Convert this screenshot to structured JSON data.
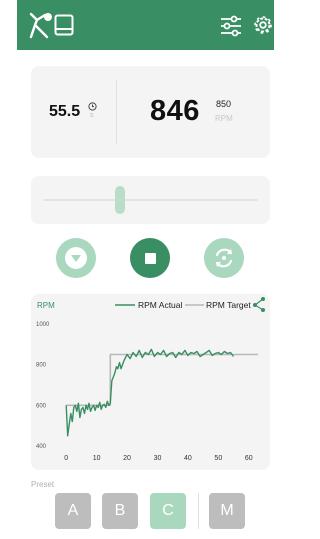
{
  "colors": {
    "header": "#3a8e63",
    "accent": "#3a8e63",
    "accent_light": "#a9d8bf",
    "card": "#f4f4f4",
    "preset_inactive": "#bdbdbd",
    "target_line": "#b8b8b8"
  },
  "header": {
    "left_icons": [
      "fan-icon",
      "tablet-icon"
    ],
    "right_icons": [
      "sliders-icon",
      "gear-icon"
    ]
  },
  "readout": {
    "temp_value": "55.5",
    "temp_icon": "clock-icon",
    "temp_sub": "s",
    "rpm_value": "846",
    "rpm_target": "850",
    "rpm_unit": "RPM"
  },
  "slider": {
    "level": 0.36
  },
  "controls": {
    "decrease_icon": "chevron-down-icon",
    "stop_icon": "stop-icon",
    "cycle_icon": "cycle-icon"
  },
  "chart_data": {
    "type": "line",
    "title": "",
    "ylabel": "RPM",
    "xlim": [
      -5,
      66
    ],
    "ylim": [
      400,
      1000
    ],
    "xticks": [
      0,
      10,
      20,
      30,
      40,
      50,
      60
    ],
    "yticks": [
      400,
      600,
      800,
      1000
    ],
    "grid": false,
    "legend_position": "top-right",
    "series": [
      {
        "name": "RPM Actual",
        "color": "#3a8e63",
        "x": [
          0,
          0.5,
          1,
          1.5,
          2,
          2.5,
          3,
          3.5,
          4,
          4.5,
          5,
          5.5,
          6,
          6.5,
          7,
          7.5,
          8,
          8.5,
          9,
          9.5,
          10,
          10.5,
          11,
          11.5,
          12,
          12.5,
          13,
          13.5,
          14,
          14.5,
          15,
          15.5,
          16,
          16.5,
          17,
          17.5,
          18,
          19,
          20,
          21,
          22,
          23,
          24,
          25,
          26,
          27,
          28,
          29,
          30,
          31,
          32,
          33,
          34,
          35,
          36,
          37,
          38,
          39,
          40,
          41,
          42,
          43,
          44,
          45,
          46,
          47,
          48,
          49,
          50,
          51,
          52,
          53,
          54,
          55
        ],
        "y": [
          600,
          450,
          510,
          560,
          520,
          590,
          600,
          570,
          610,
          540,
          580,
          590,
          560,
          600,
          580,
          610,
          570,
          590,
          600,
          575,
          600,
          590,
          615,
          580,
          600,
          605,
          590,
          620,
          600,
          610,
          720,
          740,
          760,
          790,
          780,
          810,
          780,
          820,
          850,
          830,
          860,
          840,
          870,
          835,
          860,
          850,
          875,
          840,
          860,
          850,
          870,
          840,
          855,
          860,
          835,
          860,
          850,
          870,
          845,
          860,
          855,
          865,
          840,
          850,
          860,
          870,
          845,
          855,
          860,
          850,
          865,
          855,
          860,
          840
        ]
      },
      {
        "name": "RPM Target",
        "color": "#b8b8b8",
        "x": [
          0,
          14.5,
          14.5,
          63
        ],
        "y": [
          600,
          600,
          850,
          850
        ]
      }
    ]
  },
  "preset": {
    "label": "Preset",
    "buttons": [
      "A",
      "B",
      "C",
      "M"
    ],
    "active": "C"
  }
}
